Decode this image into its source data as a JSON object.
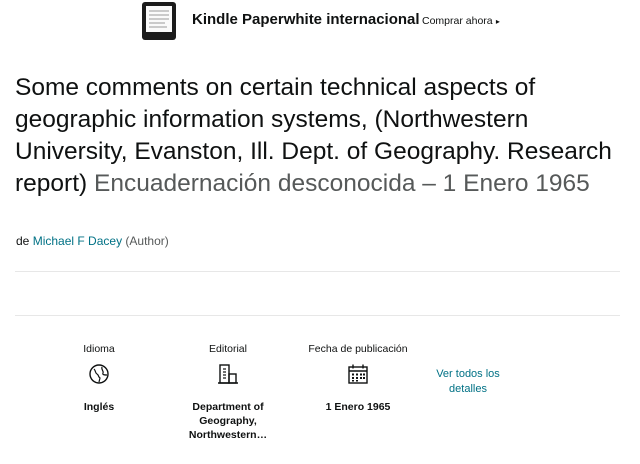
{
  "promo": {
    "product_name": "Kindle Paperwhite internacional",
    "cta_label": "Comprar ahora",
    "cta_icon": "chevron-right-icon"
  },
  "book": {
    "title": "Some comments on certain technical aspects of geographic information systems, (Northwestern University, Evanston, Ill. Dept. of Geography. Research report)",
    "format": "Encuadernación desconocida – 1 Enero 1965",
    "byline_prefix": "de",
    "author": "Michael F Dacey",
    "author_role": "(Author)"
  },
  "attributes": [
    {
      "label": "Idioma",
      "icon": "globe-icon",
      "value": "Inglés"
    },
    {
      "label": "Editorial",
      "icon": "building-icon",
      "value": "Department of Geography, Northwestern…"
    },
    {
      "label": "Fecha de publicación",
      "icon": "calendar-icon",
      "value": "1 Enero 1965"
    }
  ],
  "details_link": "Ver todos los detalles",
  "colors": {
    "link": "#007185",
    "text": "#0f1111",
    "secondary_text": "#565959",
    "divider": "#e7e7e7"
  }
}
